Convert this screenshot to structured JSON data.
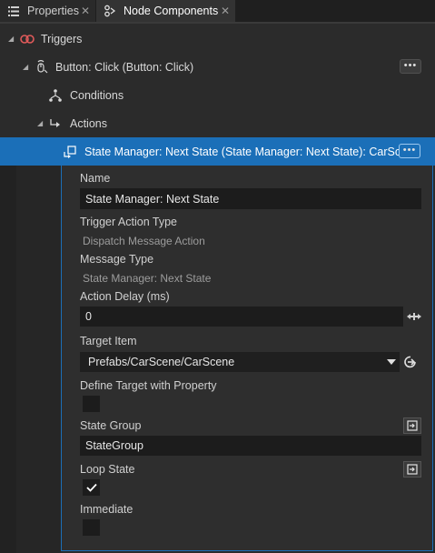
{
  "tabs": [
    {
      "label": "Properties",
      "icon": "list-icon",
      "close": "✕"
    },
    {
      "label": "Node Components",
      "icon": "node-components-icon",
      "close": "✕"
    }
  ],
  "tree": {
    "triggers": {
      "label": "Triggers",
      "icon": "trigger-icon"
    },
    "button_click": {
      "label": "Button: Click (Button: Click)",
      "icon": "click-icon",
      "more": "•••"
    },
    "conditions": {
      "label": "Conditions",
      "icon": "conditions-icon"
    },
    "actions": {
      "label": "Actions",
      "icon": "actions-icon"
    },
    "state_manager": {
      "label": "State Manager: Next State (State Manager: Next State): CarScene",
      "icon": "action-item-icon",
      "more": "•••"
    }
  },
  "properties": {
    "name": {
      "label": "Name",
      "value": "State Manager: Next State"
    },
    "trigger_action_type": {
      "label": "Trigger Action Type",
      "value": "Dispatch Message Action"
    },
    "message_type": {
      "label": "Message Type",
      "value": "State Manager: Next State"
    },
    "action_delay": {
      "label": "Action Delay (ms)",
      "value": "0"
    },
    "target_item": {
      "label": "Target Item",
      "value": "Prefabs/CarScene/CarScene"
    },
    "define_target": {
      "label": "Define Target with Property",
      "checked": false
    },
    "state_group": {
      "label": "State Group",
      "value": "StateGroup"
    },
    "loop_state": {
      "label": "Loop State",
      "checked": true
    },
    "immediate": {
      "label": "Immediate",
      "checked": false
    }
  },
  "colors": {
    "selection": "#1b6fb8",
    "trigger_icon": "#e05a5a",
    "background": "#2b2b2b"
  }
}
